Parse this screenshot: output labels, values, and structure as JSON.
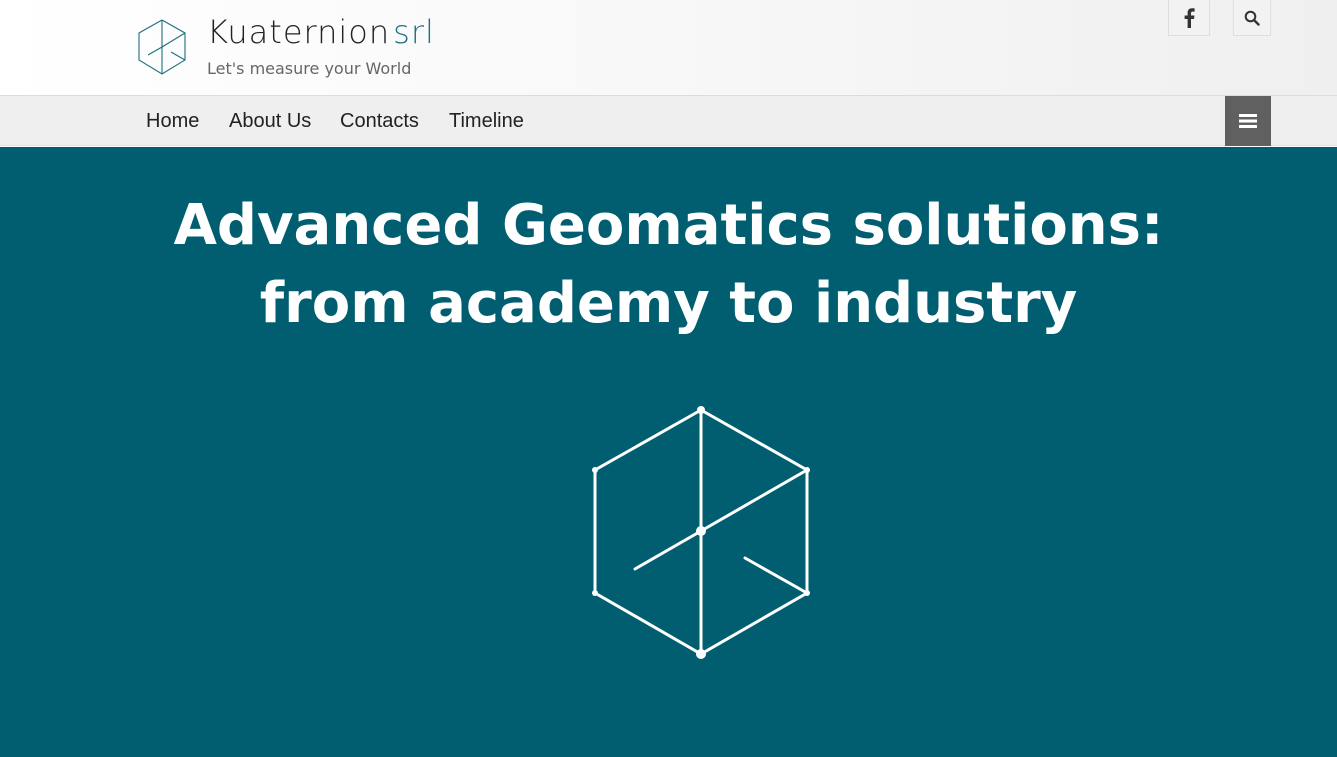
{
  "brand": {
    "name": "Kuaternion",
    "suffix": "srl",
    "tagline": "Let's measure your World",
    "accent_color": "#1e6f80"
  },
  "header": {
    "social": [
      {
        "icon": "facebook-icon"
      },
      {
        "icon": "search-icon"
      }
    ]
  },
  "nav": {
    "items": [
      {
        "label": "Home"
      },
      {
        "label": "About Us"
      },
      {
        "label": "Contacts"
      },
      {
        "label": "Timeline"
      }
    ],
    "menu_icon": "hamburger-menu-icon"
  },
  "hero": {
    "background_color": "#005e70",
    "title_line1": "Advanced Geomatics solutions:",
    "title_line2": "from academy to industry",
    "graphic": "cube-logo-icon"
  }
}
